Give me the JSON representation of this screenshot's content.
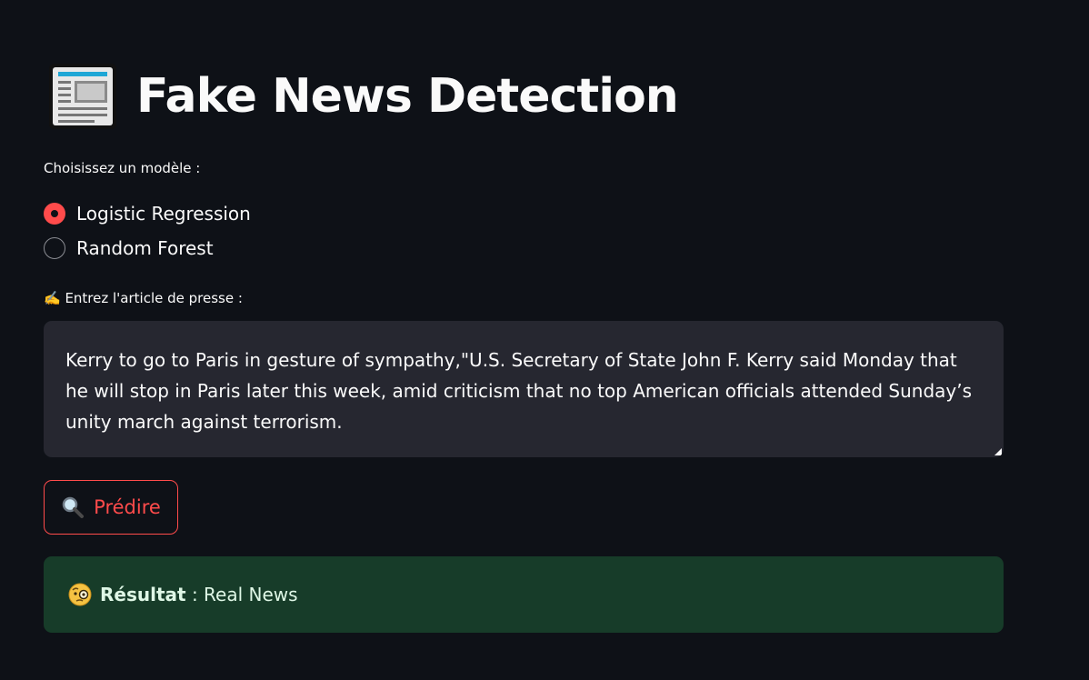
{
  "app": {
    "title": "Fake News Detection",
    "title_icon": "newspaper-icon"
  },
  "model_select": {
    "label": "Choisissez un modèle :",
    "options": [
      "Logistic Regression",
      "Random Forest"
    ],
    "selected": "Logistic Regression"
  },
  "article_input": {
    "icon": "writing-hand-icon",
    "label": "✍️ Entrez l'article de presse :",
    "value": "Kerry to go to Paris in gesture of sympathy,\"U.S. Secretary of State John F. Kerry said Monday that he will stop in Paris later this week, amid criticism that no top American officials attended Sunday’s unity march against terrorism."
  },
  "predict_button": {
    "icon": "magnifier-icon",
    "label": "Prédire"
  },
  "result": {
    "icon": "monocle-face-icon",
    "label": "Résultat",
    "separator": " : ",
    "value": "Real News"
  },
  "colors": {
    "background": "#0e1117",
    "accent": "#ff4b4b",
    "input_background": "#262730",
    "success_background": "#173c29",
    "text": "#fafafa"
  }
}
